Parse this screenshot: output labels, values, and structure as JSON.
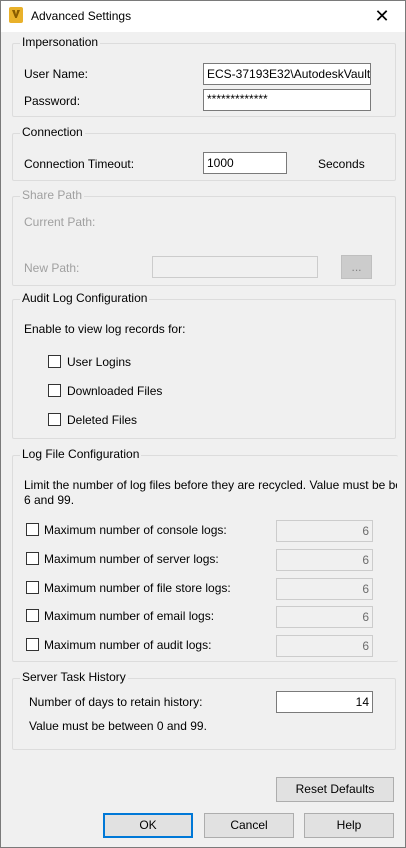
{
  "window": {
    "title": "Advanced Settings",
    "close_glyph": "✕"
  },
  "impersonation": {
    "legend": "Impersonation",
    "username_label": "User Name:",
    "username_value": "ECS-37193E32\\AutodeskVault",
    "password_label": "Password:",
    "password_value": "*************"
  },
  "connection": {
    "legend": "Connection",
    "timeout_label": "Connection Timeout:",
    "timeout_value": "1000",
    "unit": "Seconds"
  },
  "share_path": {
    "legend": "Share Path",
    "current_label": "Current Path:",
    "new_label": "New Path:",
    "new_value": "",
    "browse_label": "..."
  },
  "audit_log": {
    "legend": "Audit Log Configuration",
    "description": "Enable to view log records for:",
    "options": [
      {
        "label": "User Logins",
        "checked": false
      },
      {
        "label": "Downloaded Files",
        "checked": false
      },
      {
        "label": "Deleted Files",
        "checked": false
      }
    ]
  },
  "log_file": {
    "legend": "Log File Configuration",
    "description_line1": "Limit the number of log files before they are recycled. Value must be be",
    "description_line2": "6 and 99.",
    "rows": [
      {
        "label": "Maximum number of console logs:",
        "checked": false,
        "value": "6"
      },
      {
        "label": "Maximum number of server logs:",
        "checked": false,
        "value": "6"
      },
      {
        "label": "Maximum number of file store logs:",
        "checked": false,
        "value": "6"
      },
      {
        "label": "Maximum number of email logs:",
        "checked": false,
        "value": "6"
      },
      {
        "label": "Maximum number of audit logs:",
        "checked": false,
        "value": "6"
      }
    ]
  },
  "task_history": {
    "legend": "Server Task History",
    "days_label": "Number of days to retain history:",
    "days_value": "14",
    "hint": "Value must be between 0 and 99."
  },
  "buttons": {
    "reset": "Reset Defaults",
    "ok": "OK",
    "cancel": "Cancel",
    "help": "Help"
  },
  "colors": {
    "focus_border": "#0078d7",
    "window_bg": "#f0f0f0"
  }
}
